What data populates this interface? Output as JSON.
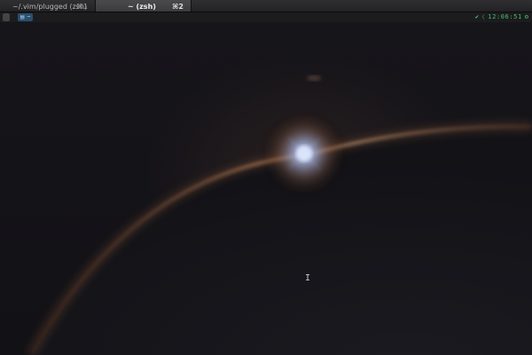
{
  "tabs": [
    {
      "title": "~/.vim/plugged (zsh)",
      "shortcut": "⌘1",
      "active": false
    },
    {
      "title": "~ (zsh)",
      "shortcut": "⌘2",
      "active": true
    }
  ],
  "statusline": {
    "apple_icon": "apple-icon",
    "path_icon": "folder-icon",
    "path": "~",
    "right": {
      "check_icon": "check-icon",
      "time": "12:06:51",
      "gear_icon": "gear-icon"
    }
  },
  "colors": {
    "background": "#141317",
    "tab_active": "#3f3f42",
    "path_segment": "#2b4f69",
    "clock": "#4dbb6d"
  }
}
